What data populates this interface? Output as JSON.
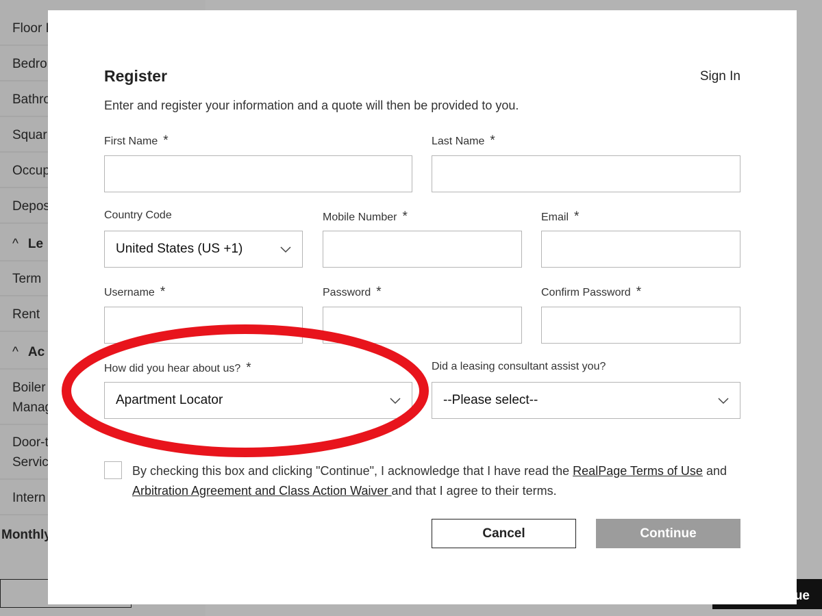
{
  "background": {
    "sidebar_items": [
      "Floor P",
      "Bedro",
      "Bathro",
      "Squar",
      "Occup",
      "Depos",
      "Term",
      "Rent",
      "Boiler",
      "Manag",
      "Door-t",
      "Servic",
      "Intern"
    ],
    "section_heads": [
      "Le",
      "Ac"
    ],
    "monthly_label": "Monthly",
    "bottom_right_text": "ue"
  },
  "modal": {
    "title": "Register",
    "sign_in": "Sign In",
    "subtitle": "Enter and register your information and a quote will then be provided to you.",
    "required_marker": "*",
    "fields": {
      "first_name": {
        "label": "First Name",
        "value": ""
      },
      "last_name": {
        "label": "Last Name",
        "value": ""
      },
      "country_code": {
        "label": "Country Code",
        "value": "United States (US +1)"
      },
      "mobile_number": {
        "label": "Mobile Number",
        "value": ""
      },
      "email": {
        "label": "Email",
        "value": ""
      },
      "username": {
        "label": "Username",
        "value": ""
      },
      "password": {
        "label": "Password",
        "value": ""
      },
      "confirm_password": {
        "label": "Confirm Password",
        "value": ""
      },
      "hear_about": {
        "label": "How did you hear about us?",
        "value": "Apartment Locator"
      },
      "leasing_consultant": {
        "label": "Did a leasing consultant assist you?",
        "value": "--Please select--"
      }
    },
    "consent": {
      "checked": false,
      "text_1": "By checking this box and clicking \"Continue\", I acknowledge that I have read the ",
      "link_1": "RealPage Terms of Use",
      "text_2": " and ",
      "link_2": "Arbitration Agreement and Class Action Waiver ",
      "text_3": "and that I agree to their terms."
    },
    "buttons": {
      "cancel": "Cancel",
      "continue": "Continue"
    }
  },
  "colors": {
    "annotation": "#e8141c",
    "overlay": "#b3b3b3",
    "disabled_button": "#9c9c9c"
  },
  "icons": {
    "select_chevron": "chevron-down-icon",
    "section_caret": "chevron-up-icon"
  }
}
